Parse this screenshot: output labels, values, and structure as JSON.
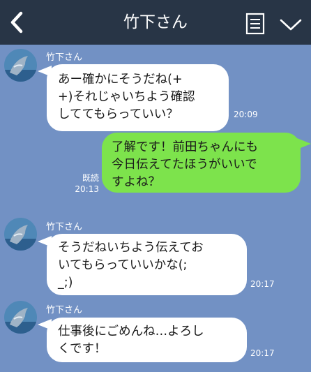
{
  "header": {
    "title": "竹下さん",
    "back_icon": "chevron-left-icon",
    "menu_icon": "notes-icon",
    "expand_icon": "chevron-down-icon",
    "bg_color": "#283546"
  },
  "chat_bg_color": "#7291c4",
  "messages": [
    {
      "sender": "竹下さん",
      "lines": [
        "あー確かにそうだね(+",
        "+)それじゃいちよう確認",
        "しててもらっていい？"
      ],
      "time": "20:09",
      "direction": "incoming"
    },
    {
      "lines": [
        "了解です！前田ちゃんにも",
        "今日伝えてたほうがいいで",
        "すよね？"
      ],
      "read": "既読",
      "time": "20:13",
      "direction": "outgoing",
      "bubble_color": "#7de34c"
    },
    {
      "sender": "竹下さん",
      "lines": [
        "そうだねいちよう伝えてお",
        "いてもらっていいかな(;",
        "_;)"
      ],
      "time": "20:17",
      "direction": "incoming"
    },
    {
      "sender": "竹下さん",
      "lines": [
        "仕事後にごめんね…よろし",
        "くです！"
      ],
      "time": "20:17",
      "direction": "incoming"
    }
  ]
}
